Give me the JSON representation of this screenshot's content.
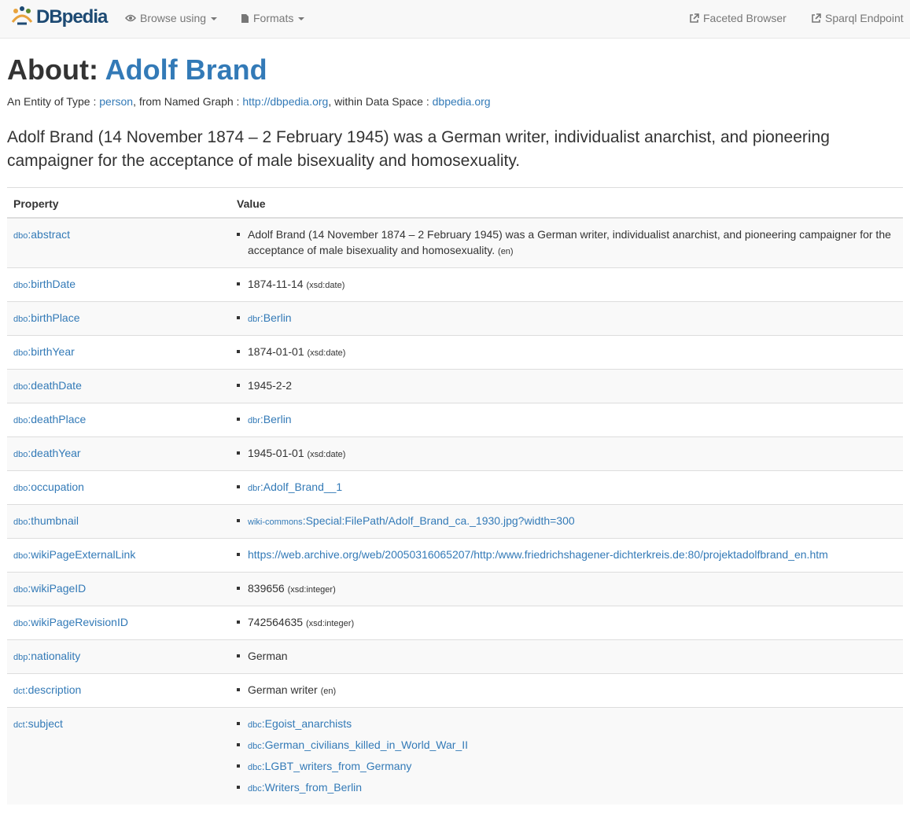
{
  "navbar": {
    "brand": "DBpedia",
    "browse_label": "Browse using",
    "formats_label": "Formats",
    "faceted_label": "Faceted Browser",
    "sparql_label": "Sparql Endpoint"
  },
  "header": {
    "about_label": "About:",
    "entity": "Adolf Brand",
    "type_prefix": "An Entity of Type : ",
    "type_value": "person",
    "graph_prefix": ", from Named Graph : ",
    "graph_value": "http://dbpedia.org",
    "space_prefix": ", within Data Space : ",
    "space_value": "dbpedia.org"
  },
  "lead": "Adolf Brand (14 November 1874 – 2 February 1945) was a German writer, individualist anarchist, and pioneering campaigner for the acceptance of male bisexuality and homosexuality.",
  "table": {
    "col_property": "Property",
    "col_value": "Value",
    "rows": [
      {
        "pp": "dbo",
        "pn": "abstract",
        "values": [
          {
            "text": "Adolf Brand (14 November 1874 – 2 February 1945) was a German writer, individualist anarchist, and pioneering campaigner for the acceptance of male bisexuality and homosexuality.",
            "tag": "(en)"
          }
        ]
      },
      {
        "pp": "dbo",
        "pn": "birthDate",
        "values": [
          {
            "text": "1874-11-14",
            "tag": "(xsd:date)"
          }
        ]
      },
      {
        "pp": "dbo",
        "pn": "birthPlace",
        "values": [
          {
            "lp": "dbr",
            "ln": "Berlin"
          }
        ]
      },
      {
        "pp": "dbo",
        "pn": "birthYear",
        "values": [
          {
            "text": "1874-01-01",
            "tag": "(xsd:date)"
          }
        ]
      },
      {
        "pp": "dbo",
        "pn": "deathDate",
        "values": [
          {
            "text": "1945-2-2"
          }
        ]
      },
      {
        "pp": "dbo",
        "pn": "deathPlace",
        "values": [
          {
            "lp": "dbr",
            "ln": "Berlin"
          }
        ]
      },
      {
        "pp": "dbo",
        "pn": "deathYear",
        "values": [
          {
            "text": "1945-01-01",
            "tag": "(xsd:date)"
          }
        ]
      },
      {
        "pp": "dbo",
        "pn": "occupation",
        "values": [
          {
            "lp": "dbr",
            "ln": "Adolf_Brand__1"
          }
        ]
      },
      {
        "pp": "dbo",
        "pn": "thumbnail",
        "values": [
          {
            "lp": "wiki-commons",
            "ln": "Special:FilePath/Adolf_Brand_ca._1930.jpg?width=300"
          }
        ]
      },
      {
        "pp": "dbo",
        "pn": "wikiPageExternalLink",
        "values": [
          {
            "lp": "",
            "ln": "https://web.archive.org/web/20050316065207/http:/www.friedrichshagener-dichterkreis.de:80/projektadolfbrand_en.htm"
          }
        ]
      },
      {
        "pp": "dbo",
        "pn": "wikiPageID",
        "values": [
          {
            "text": "839656",
            "tag": "(xsd:integer)"
          }
        ]
      },
      {
        "pp": "dbo",
        "pn": "wikiPageRevisionID",
        "values": [
          {
            "text": "742564635",
            "tag": "(xsd:integer)"
          }
        ]
      },
      {
        "pp": "dbp",
        "pn": "nationality",
        "values": [
          {
            "text": "German"
          }
        ]
      },
      {
        "pp": "dct",
        "pn": "description",
        "values": [
          {
            "text": "German writer",
            "tag": "(en)"
          }
        ]
      },
      {
        "pp": "dct",
        "pn": "subject",
        "values": [
          {
            "lp": "dbc",
            "ln": "Egoist_anarchists"
          },
          {
            "lp": "dbc",
            "ln": "German_civilians_killed_in_World_War_II"
          },
          {
            "lp": "dbc",
            "ln": "LGBT_writers_from_Germany"
          },
          {
            "lp": "dbc",
            "ln": "Writers_from_Berlin"
          }
        ]
      }
    ]
  }
}
